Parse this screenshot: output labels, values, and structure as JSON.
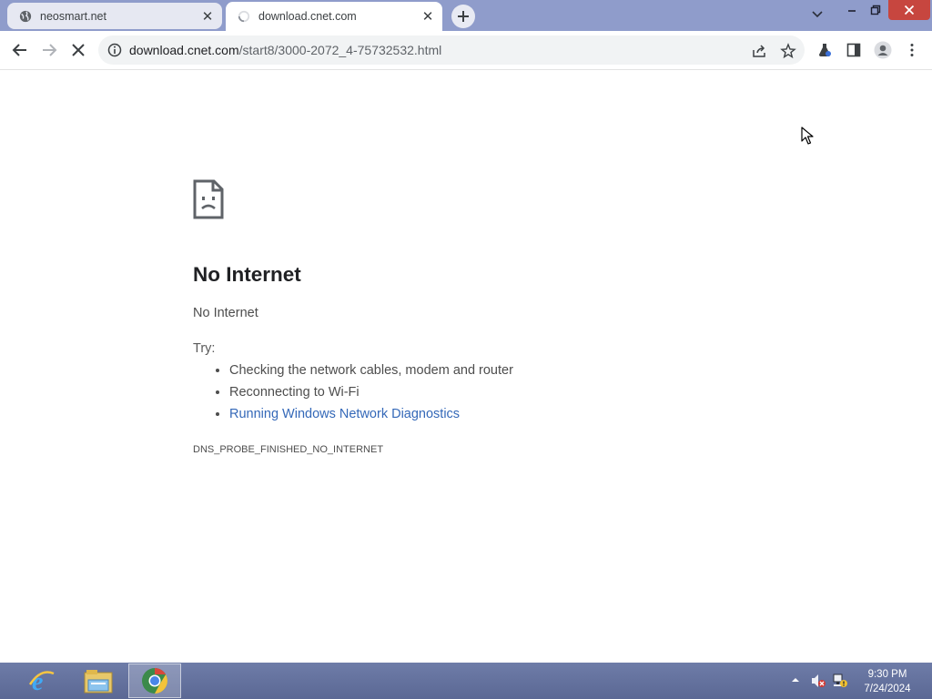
{
  "browser": {
    "tabs": [
      {
        "title": "neosmart.net",
        "active": false,
        "favicon": "globe-icon"
      },
      {
        "title": "download.cnet.com",
        "active": true,
        "favicon": "loading-spinner-icon"
      }
    ],
    "address_bar": {
      "domain": "download.cnet.com",
      "path": "/start8/3000-2072_4-75732532.html"
    },
    "colors": {
      "frame": "#8f9ccb",
      "link": "#3468b8",
      "close_button": "#c7463f"
    }
  },
  "error_page": {
    "title": "No Internet",
    "subtitle": "No Internet",
    "try_label": "Try:",
    "suggestions": [
      "Checking the network cables, modem and router",
      "Reconnecting to Wi-Fi",
      "Running Windows Network Diagnostics"
    ],
    "error_code": "DNS_PROBE_FINISHED_NO_INTERNET"
  },
  "taskbar": {
    "pinned": [
      "internet-explorer-icon",
      "file-explorer-icon",
      "chrome-icon"
    ],
    "clock": {
      "time": "9:30 PM",
      "date": "7/24/2024"
    }
  }
}
